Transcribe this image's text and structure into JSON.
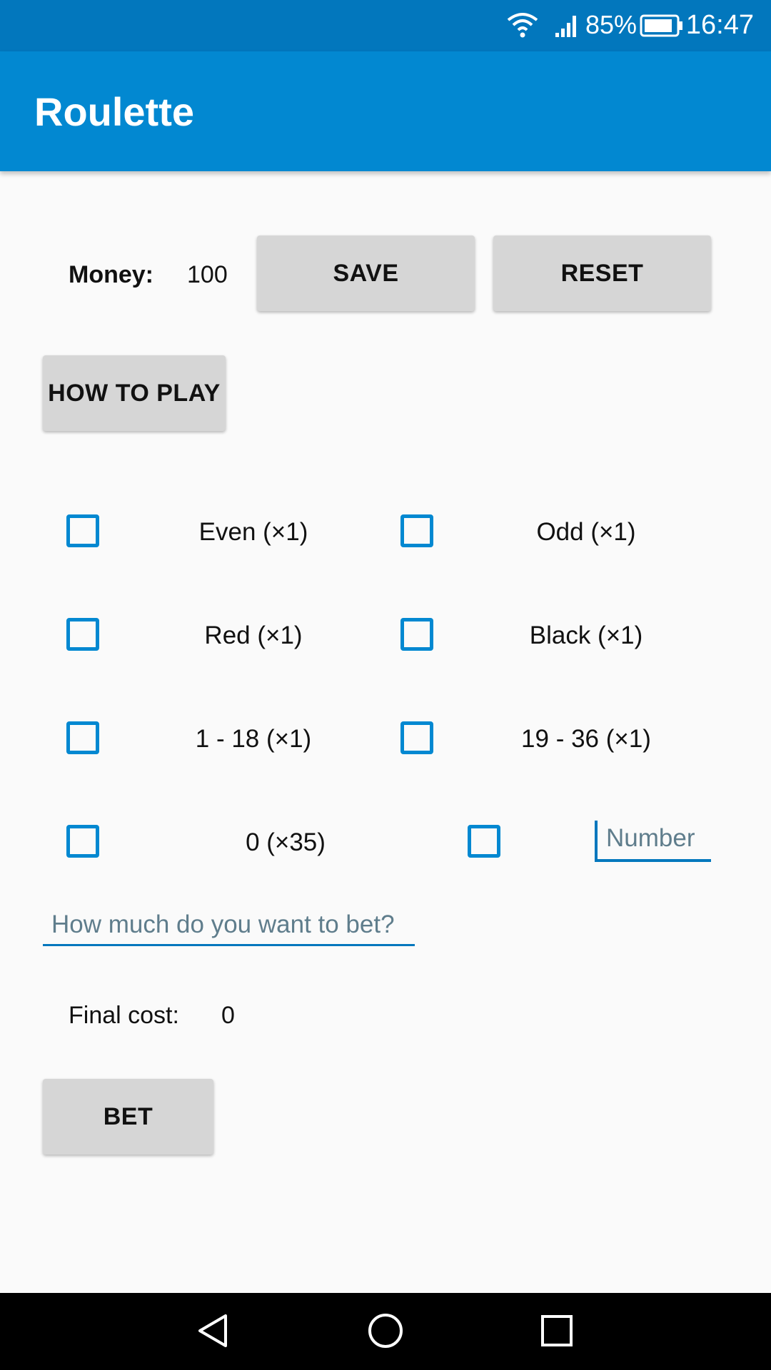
{
  "status_bar": {
    "battery_percent": "85%",
    "time": "16:47",
    "icons": [
      "wifi-icon",
      "signal-icon",
      "battery-icon"
    ]
  },
  "app_bar": {
    "title": "Roulette"
  },
  "money": {
    "label": "Money:",
    "value": "100"
  },
  "buttons": {
    "save": "SAVE",
    "reset": "RESET",
    "how_to_play": "HOW TO PLAY",
    "bet": "BET"
  },
  "options": [
    {
      "label": "Even (×1)",
      "checked": false
    },
    {
      "label": "Odd (×1)",
      "checked": false
    },
    {
      "label": "Red (×1)",
      "checked": false
    },
    {
      "label": "Black (×1)",
      "checked": false
    },
    {
      "label": "1 - 18 (×1)",
      "checked": false
    },
    {
      "label": "19 - 36 (×1)",
      "checked": false
    },
    {
      "label": "0 (×35)",
      "checked": false
    }
  ],
  "number_field": {
    "placeholder": "Number",
    "value": "",
    "checked": false
  },
  "bet_amount_field": {
    "placeholder": "How much do you want to bet?",
    "value": ""
  },
  "final_cost": {
    "label": "Final cost:",
    "value": "0"
  },
  "colors": {
    "status_bar": "#0277bd",
    "app_bar": "#0288d1",
    "accent": "#0288d1",
    "button": "#d6d6d6",
    "background": "#fafafa",
    "nav_bar": "#000000"
  },
  "nav_icons": [
    "back-icon",
    "home-icon",
    "recents-icon"
  ]
}
